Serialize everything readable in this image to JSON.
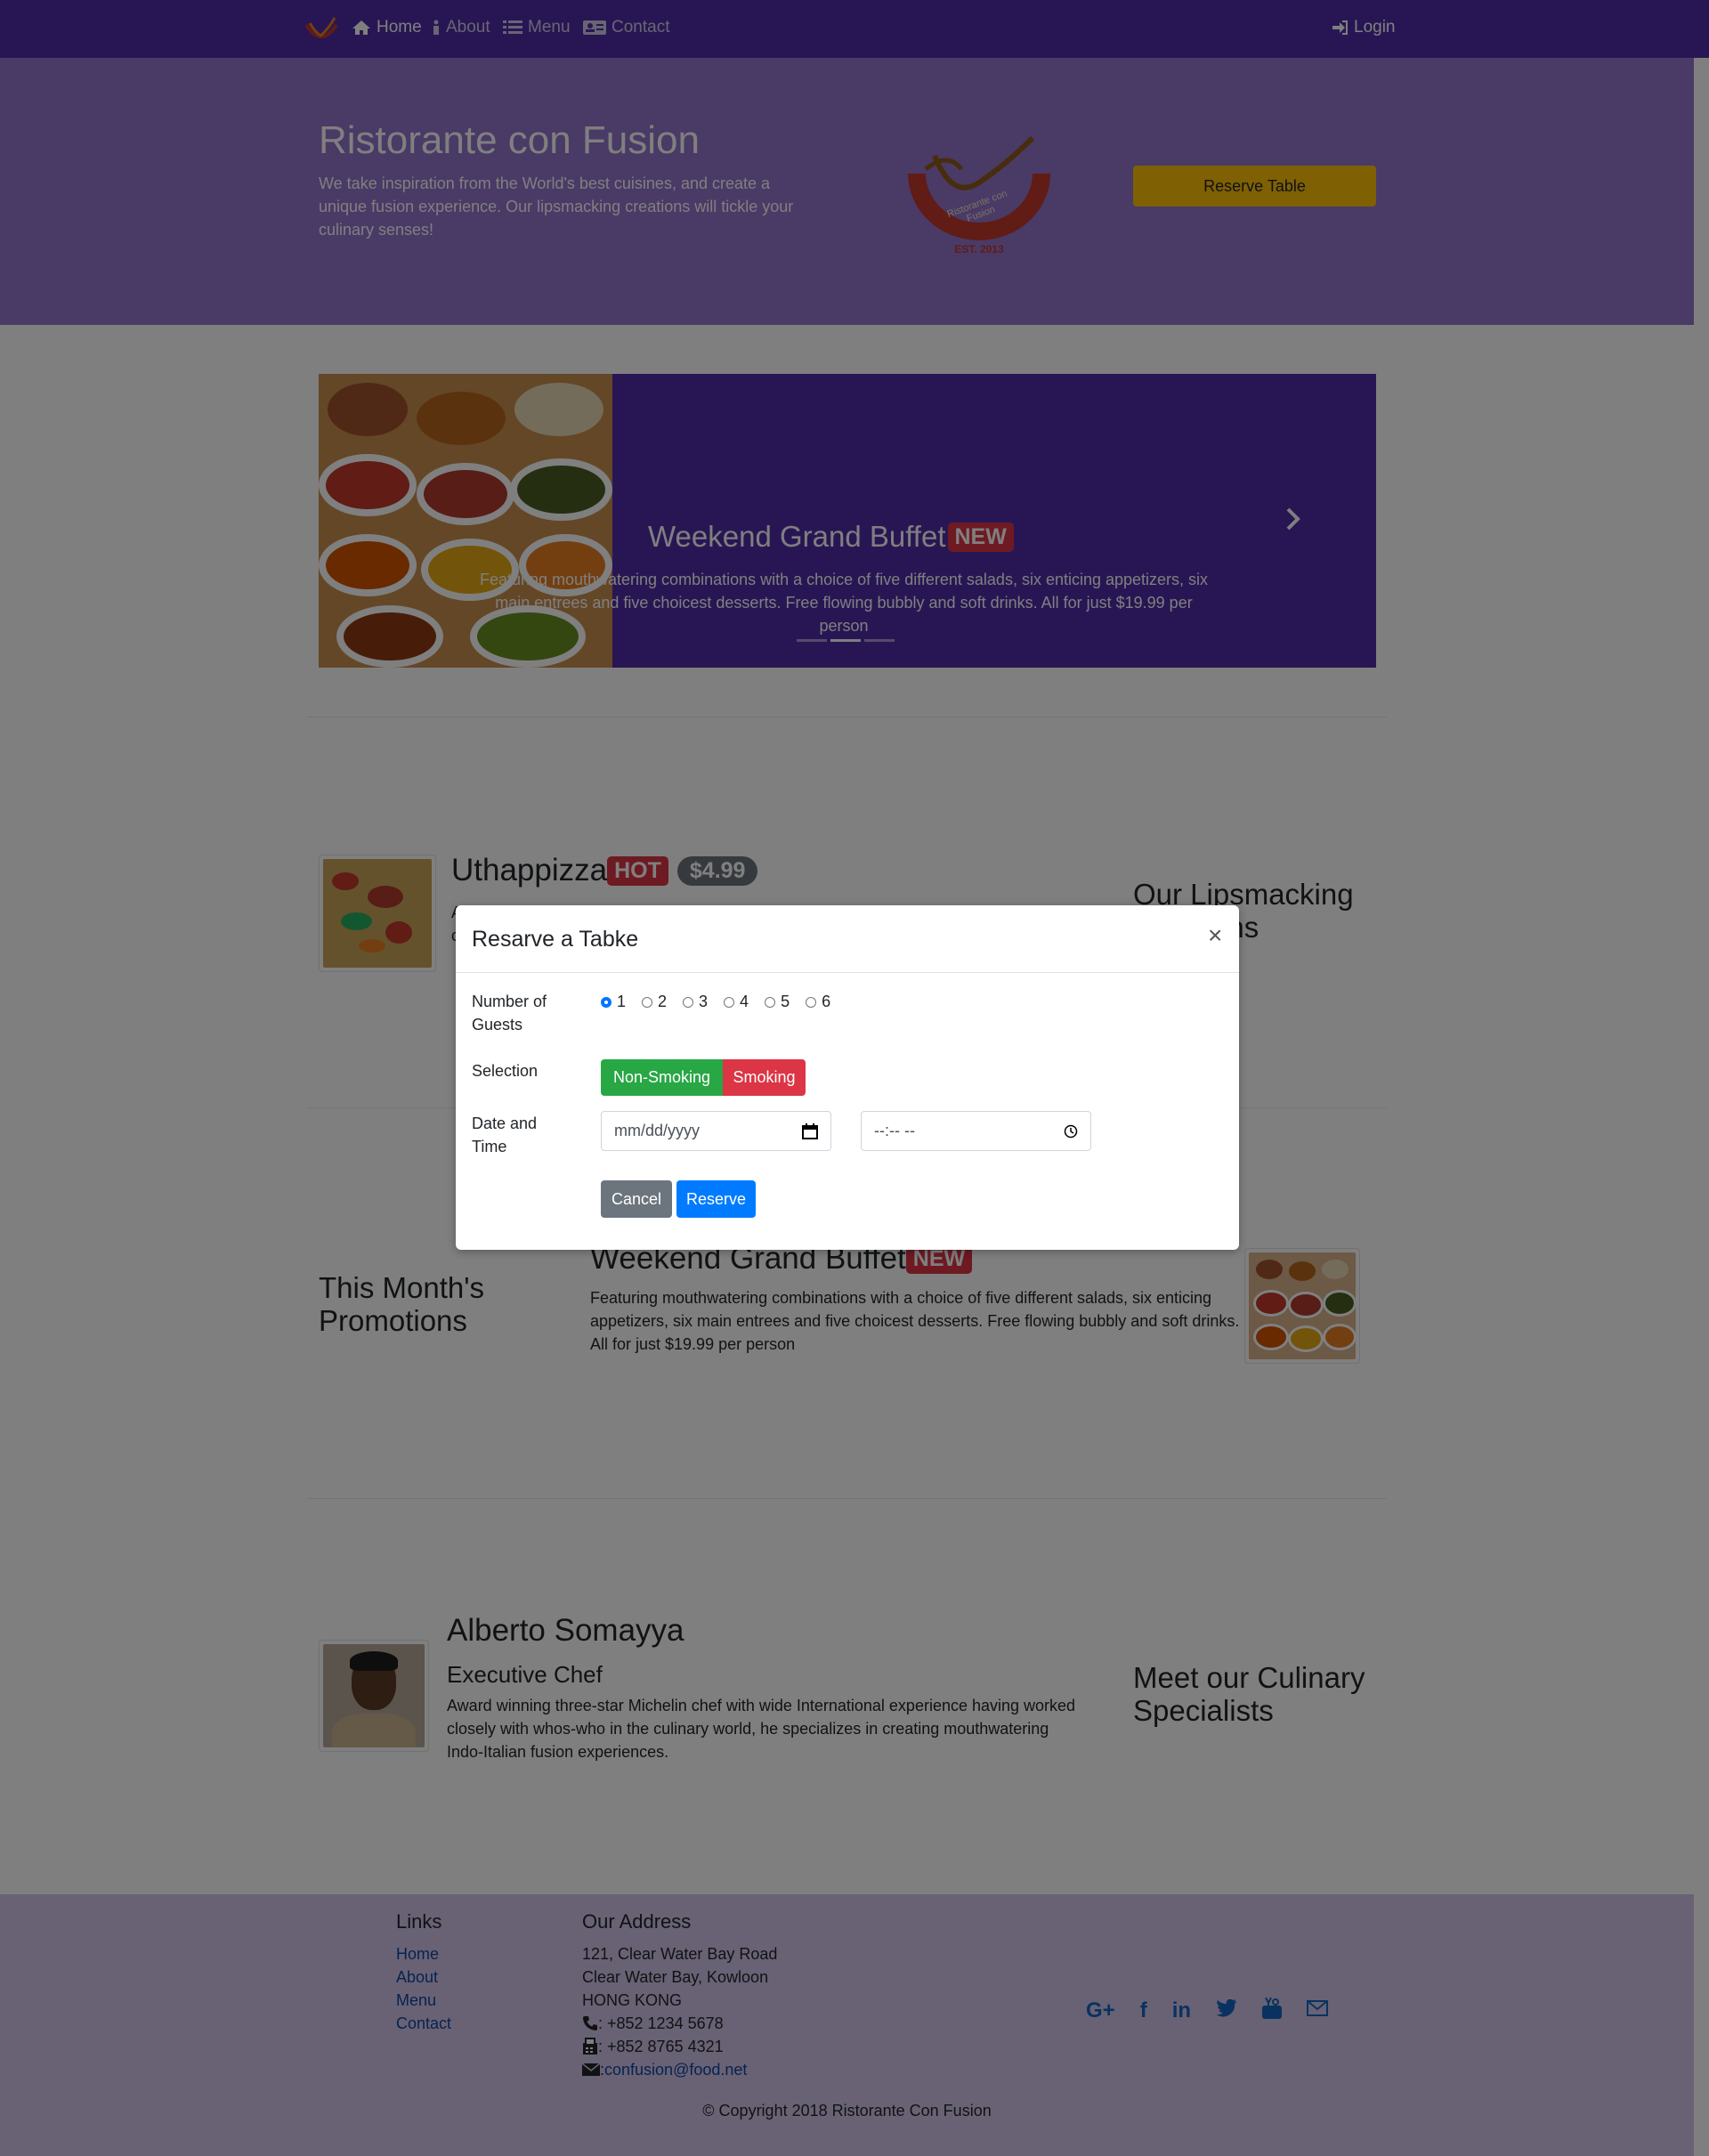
{
  "navbar": {
    "items": [
      {
        "label": "Home",
        "icon": "home-icon"
      },
      {
        "label": "About",
        "icon": "info-icon"
      },
      {
        "label": "Menu",
        "icon": "list-icon"
      },
      {
        "label": "Contact",
        "icon": "address-card-icon"
      }
    ],
    "login_label": "Login"
  },
  "jumbotron": {
    "title": "Ristorante con Fusion",
    "text": "We take inspiration from the World's best cuisines, and create a unique fusion experience. Our lipsmacking creations will tickle your culinary senses!",
    "logo_text": "Ristorante con Fusion",
    "logo_est": "EST. 2013",
    "reserve_label": "Reserve Table"
  },
  "carousel": {
    "title": "Weekend Grand Buffet",
    "badge": "NEW",
    "text": "Featuring mouthwatering combinations with a choice of five different salads, six enticing appetizers, six main entrees and five choicest desserts. Free flowing bubbly and soft drinks. All for just $19.99 per person",
    "slides": 3,
    "active_slide": 2
  },
  "dish": {
    "name": "Uthappizza",
    "badge": "HOT",
    "price": "$4.99",
    "desc_start": "A",
    "desc_start2": "c",
    "heading": "Our Lipsmacking Creations"
  },
  "promotion": {
    "heading": "This Month's Promotions",
    "name": "Weekend Grand Buffet",
    "badge": "NEW",
    "desc": "Featuring mouthwatering combinations with a choice of five different salads, six enticing appetizers, six main entrees and five choicest desserts. Free flowing bubbly and soft drinks. All for just $19.99 per person"
  },
  "chef": {
    "name": "Alberto Somayya",
    "title": "Executive Chef",
    "desc": "Award winning three-star Michelin chef with wide International experience having worked closely with whos-who in the culinary world, he specializes in creating mouthwatering Indo-Italian fusion experiences.",
    "heading": "Meet our Culinary Specialists"
  },
  "footer": {
    "links_heading": "Links",
    "links": [
      "Home",
      "About",
      "Menu",
      "Contact"
    ],
    "address_heading": "Our Address",
    "address_lines": [
      "121, Clear Water Bay Road",
      "Clear Water Bay, Kowloon",
      "HONG KONG"
    ],
    "phone": ": +852 1234 5678",
    "fax": ": +852 8765 4321",
    "email_prefix": ": ",
    "email": "confusion@food.net",
    "social_icons": [
      "google-plus-icon",
      "facebook-icon",
      "linkedin-icon",
      "twitter-icon",
      "youtube-icon",
      "envelope-icon"
    ],
    "copyright": "© Copyright 2018 Ristorante Con Fusion"
  },
  "modal": {
    "title": "Resarve a Tabke",
    "close": "×",
    "guests_label": "Number of Guests",
    "guest_options": [
      "1",
      "2",
      "3",
      "4",
      "5",
      "6"
    ],
    "guests_selected": "1",
    "selection_label": "Selection",
    "non_smoking": "Non-Smoking",
    "smoking": "Smoking",
    "datetime_label": "Date and Time",
    "date_placeholder": "mm/dd/yyyy",
    "time_placeholder": "--:-- --",
    "cancel": "Cancel",
    "reserve": "Reserve"
  },
  "colors": {
    "primary_dark": "#512da8",
    "primary": "#9575cd",
    "footer_bg": "#d1c4e9",
    "warning": "#ffc107",
    "danger": "#dc3545",
    "success": "#28a745",
    "btn_primary": "#007bff",
    "btn_secondary": "#6c757d"
  }
}
